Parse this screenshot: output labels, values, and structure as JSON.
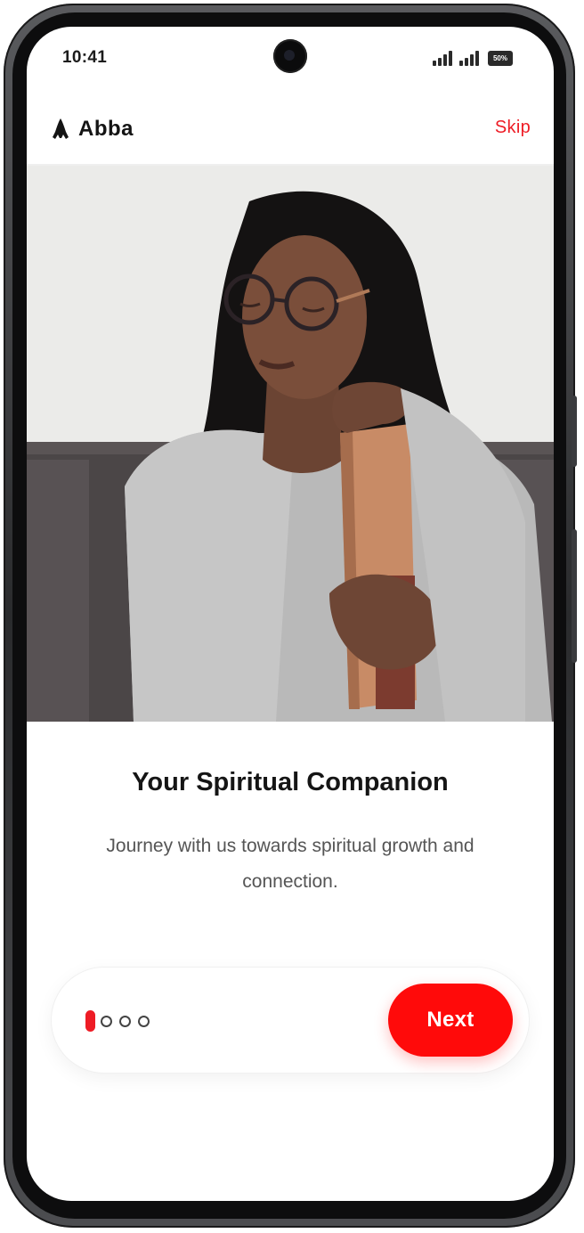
{
  "status_bar": {
    "time": "10:41",
    "battery": "50%"
  },
  "header": {
    "app_name": "Abba",
    "skip_label": "Skip",
    "logo_icon": "praying-hands-icon"
  },
  "hero": {
    "image_subject": "woman-with-glasses-holding-bible"
  },
  "onboarding": {
    "title": "Your Spiritual Companion",
    "subtitle": "Journey with us towards spiritual growth and connection."
  },
  "pagination": {
    "current": 1,
    "total": 4
  },
  "actions": {
    "next_label": "Next"
  },
  "colors": {
    "accent": "#ee1c25",
    "button": "#ff0a0a",
    "title": "#151515",
    "subtitle": "#555555"
  }
}
